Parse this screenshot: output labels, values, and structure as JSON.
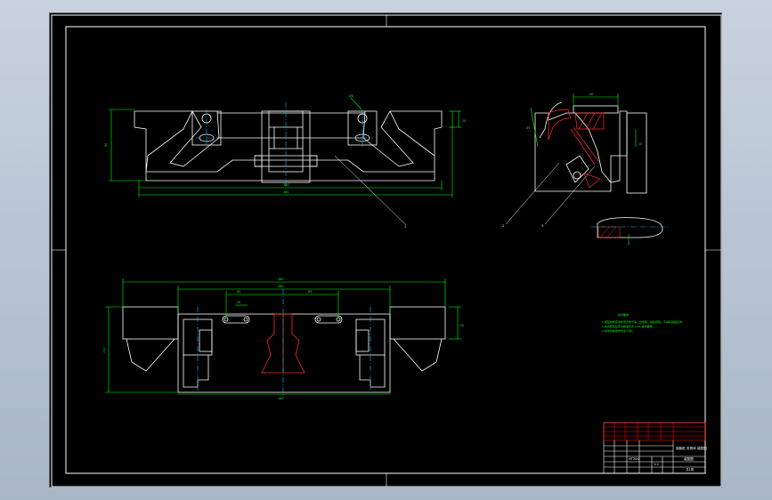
{
  "drawing": {
    "title_block": {
      "title": "钢板桩 夹具体 装配图",
      "drawing_no": "装配图",
      "material": "HT200",
      "scale": "1:2",
      "sheet": "共1张"
    },
    "notes": {
      "heading": "技术要求",
      "lines": [
        "1.装配前所有零件须清洗干净，去毛刺，锐边倒钝，不得有划痕损伤。",
        "2.夹具装配后定位精度符合 0.02 技术要求。",
        "3.夹紧机构动作灵活 可靠。"
      ]
    },
    "dimensions": {
      "top_width": "340",
      "top_overall": "360",
      "top_height": "80",
      "top_right_height": "20",
      "top_circle": "Ø8",
      "bottom_overall": "380",
      "bottom_inner": "260",
      "bottom_left_pitch": "60",
      "bottom_right_pitch": "60",
      "bottom_slot": "20",
      "bottom_height": "110",
      "bottom_right_height": "30",
      "bottom_width": "160",
      "section_top": "40",
      "section_side": "45",
      "section_right": "10"
    },
    "balloons": [
      "1",
      "2",
      "3",
      "4",
      "5",
      "6"
    ],
    "section_label": "A",
    "colors": {
      "outline": "#ffffff",
      "dimension": "#00ff00",
      "leader": "#ffffff",
      "center": "#00bfff",
      "hatch": "#ff2a2a",
      "frame": "#ffffff",
      "titleblock_red": "#ff0000"
    }
  }
}
